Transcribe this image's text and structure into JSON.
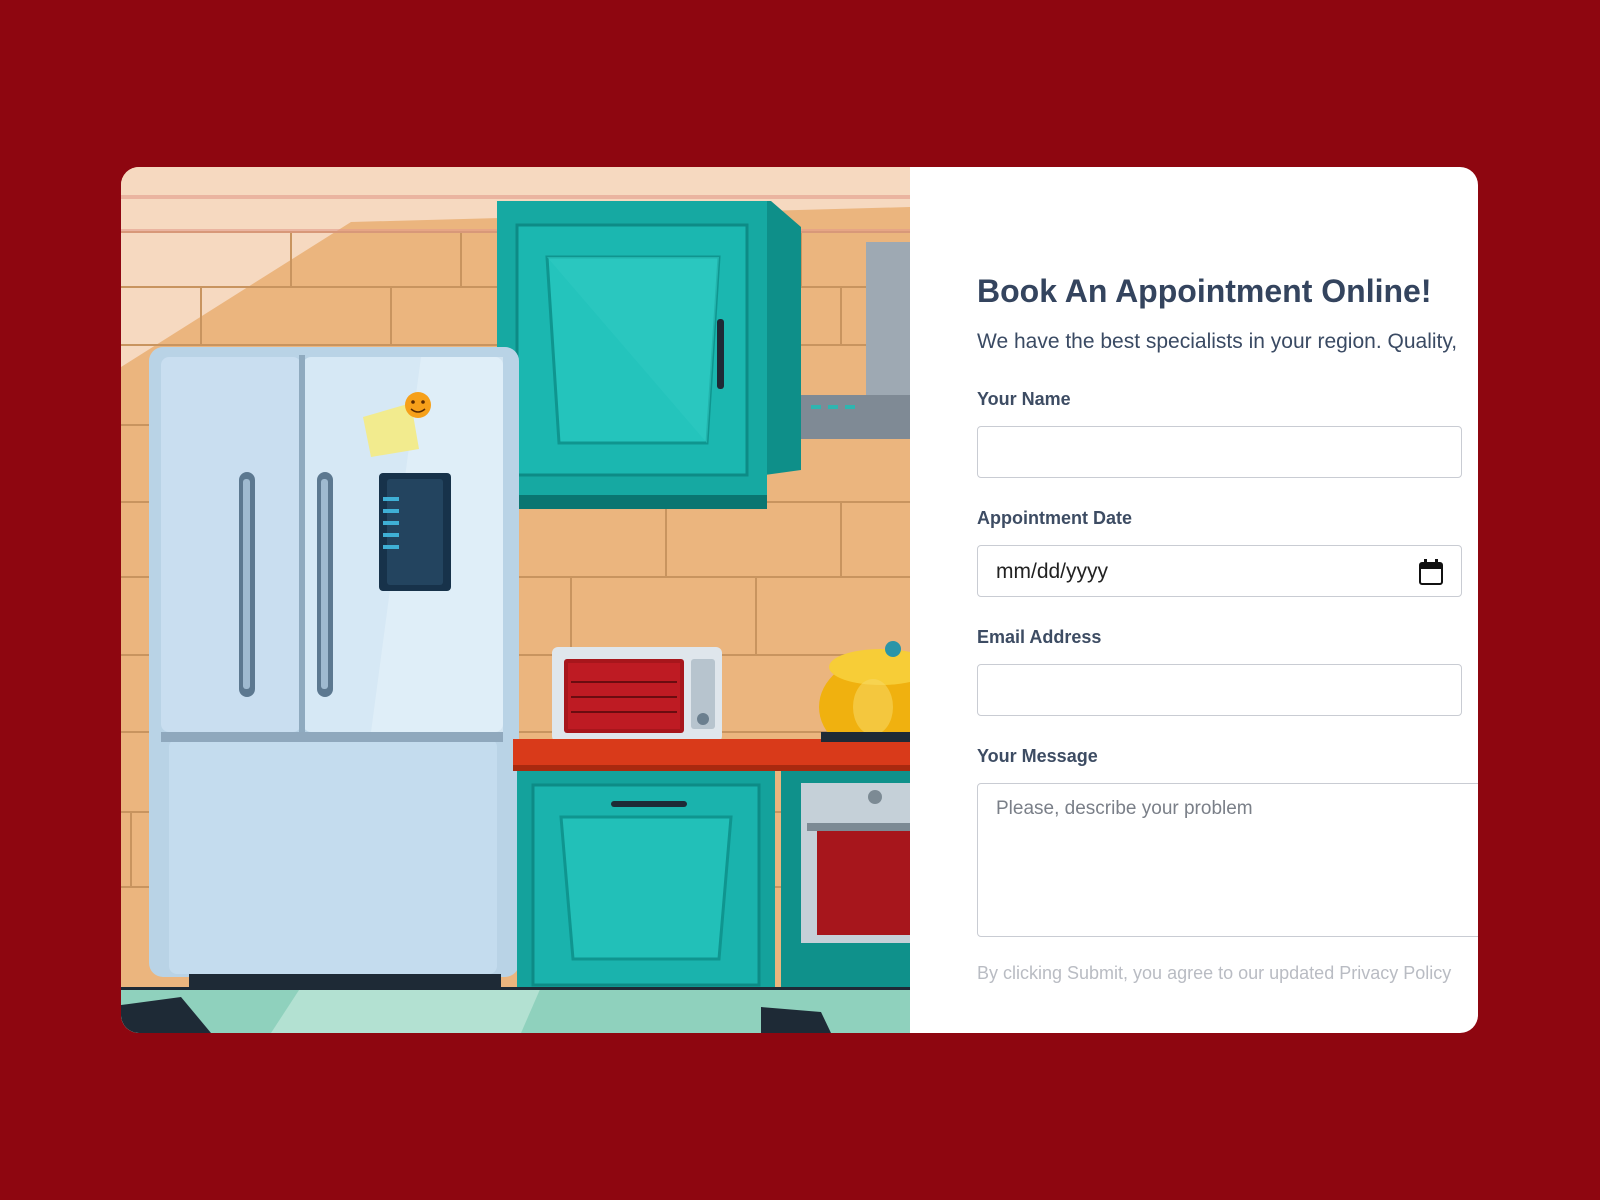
{
  "colors": {
    "page_background": "#8e0610",
    "card_background": "#ffffff",
    "title_text": "#34445e",
    "cabinet_teal": "#139e98",
    "countertop_red": "#d93a1a"
  },
  "illustration": {
    "alt": "Kitchen illustration"
  },
  "form": {
    "title": "Book An Appointment Online!",
    "subtitle": "We have the best specialists in your region. Quality,",
    "name_field": {
      "label": "Your Name",
      "value": ""
    },
    "date_field": {
      "label": "Appointment Date",
      "value": "mm/dd/yyyy",
      "icon": "calendar-icon"
    },
    "email_field": {
      "label": "Email Address",
      "value": ""
    },
    "message_field": {
      "label": "Your Message",
      "placeholder": "Please, describe your problem"
    },
    "disclaimer": "By clicking Submit, you agree to our updated Privacy Policy"
  }
}
